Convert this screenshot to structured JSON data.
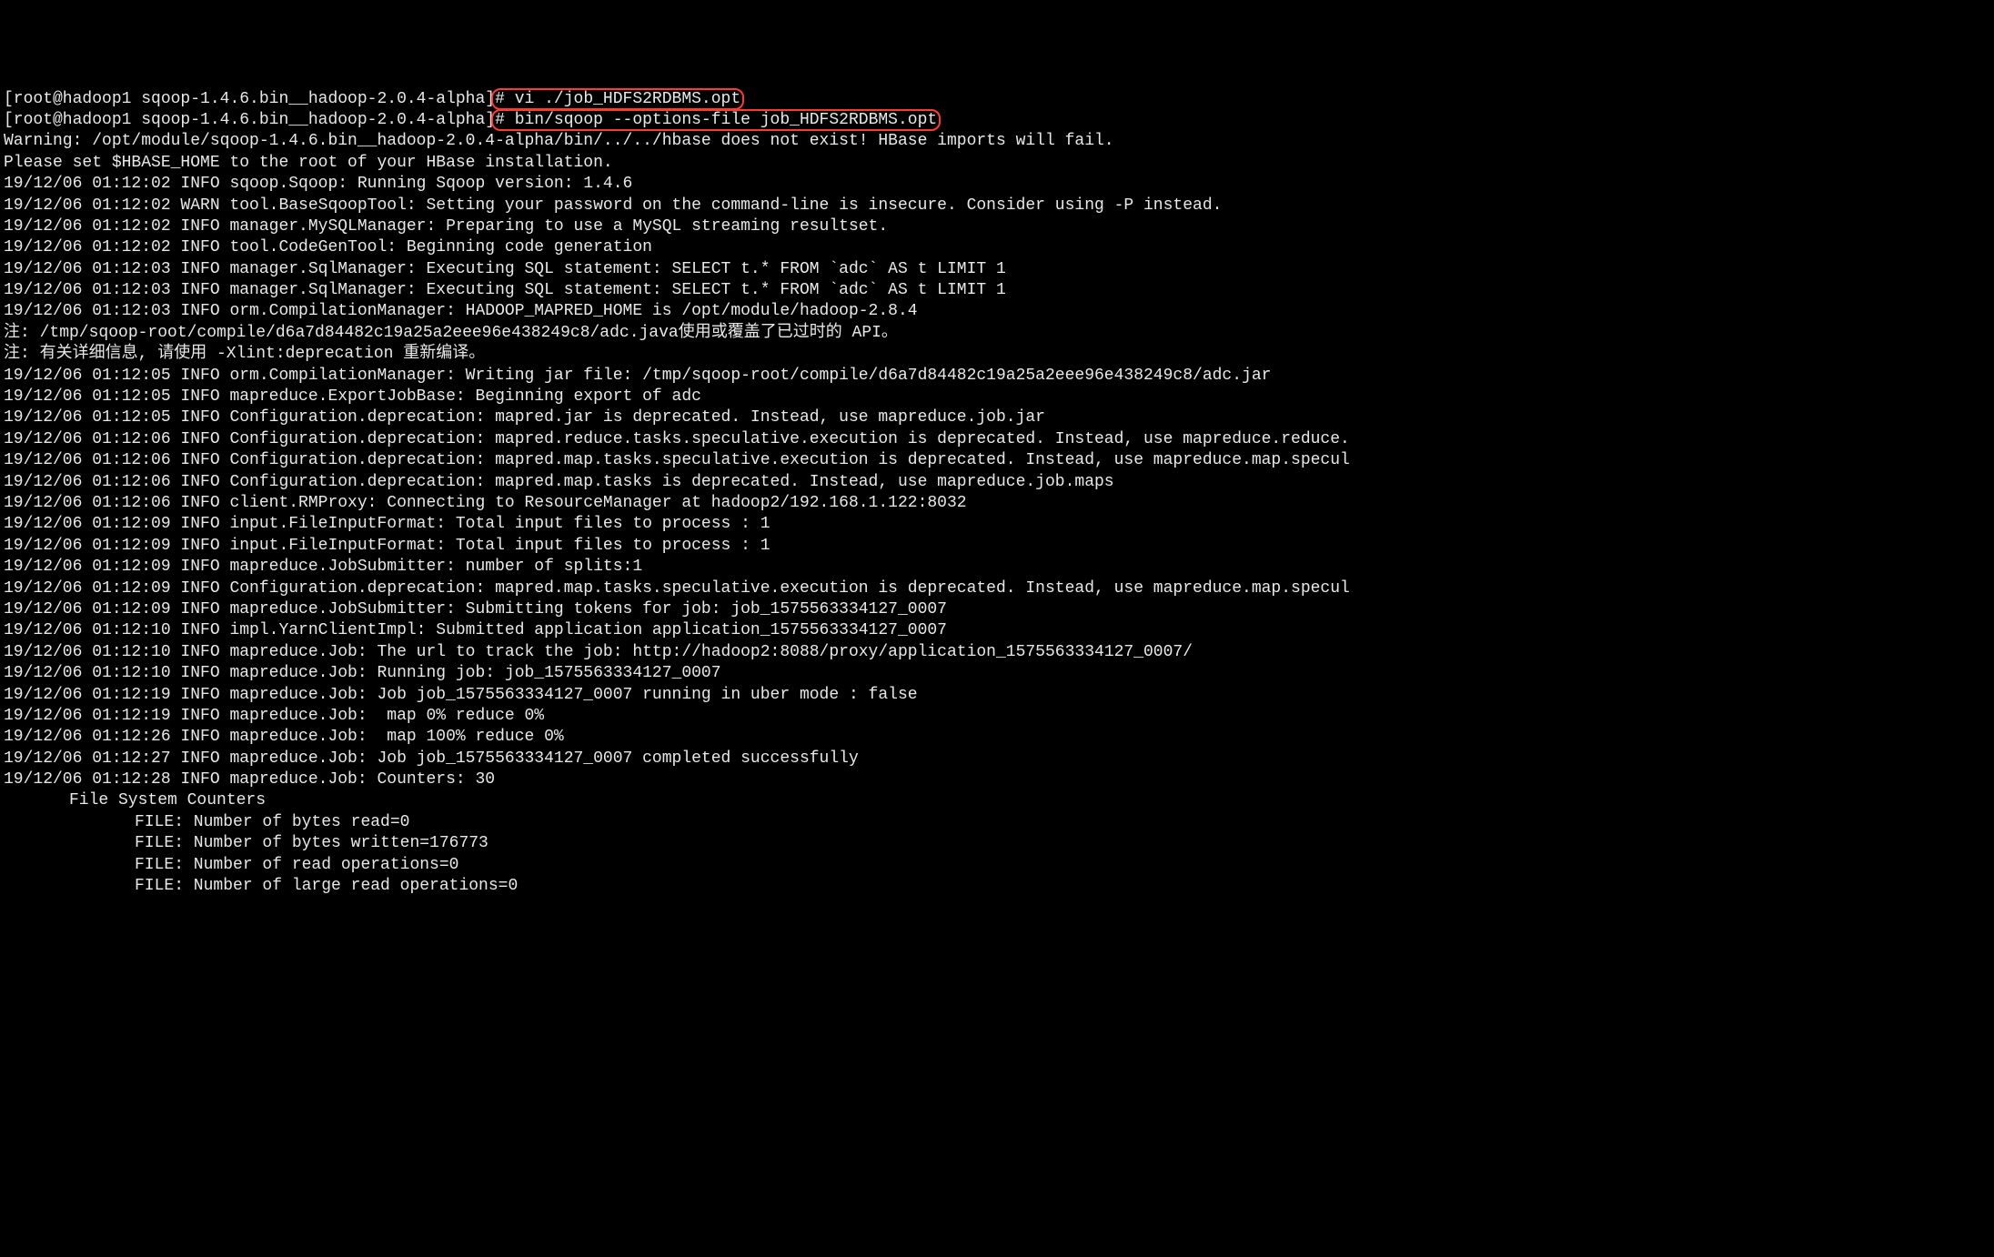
{
  "terminal": {
    "lines": [
      {
        "prompt": "[root@hadoop1 sqoop-1.4.6.bin__hadoop-2.0.4-alpha]",
        "cmd_prefix": "# ",
        "cmd": "vi ./job_HDFS2RDBMS.opt",
        "highlight": true,
        "highlight_start": "cmd_prefix"
      },
      {
        "prompt": "[root@hadoop1 sqoop-1.4.6.bin__hadoop-2.0.4-alpha]",
        "cmd_prefix": "# ",
        "cmd": "bin/sqoop --options-file job_HDFS2RDBMS.opt",
        "highlight": true,
        "highlight_start": "cmd_prefix"
      },
      {
        "text": "Warning: /opt/module/sqoop-1.4.6.bin__hadoop-2.0.4-alpha/bin/../../hbase does not exist! HBase imports will fail."
      },
      {
        "text": "Please set $HBASE_HOME to the root of your HBase installation."
      },
      {
        "text": "19/12/06 01:12:02 INFO sqoop.Sqoop: Running Sqoop version: 1.4.6"
      },
      {
        "text": "19/12/06 01:12:02 WARN tool.BaseSqoopTool: Setting your password on the command-line is insecure. Consider using -P instead."
      },
      {
        "text": "19/12/06 01:12:02 INFO manager.MySQLManager: Preparing to use a MySQL streaming resultset."
      },
      {
        "text": "19/12/06 01:12:02 INFO tool.CodeGenTool: Beginning code generation"
      },
      {
        "text": "19/12/06 01:12:03 INFO manager.SqlManager: Executing SQL statement: SELECT t.* FROM `adc` AS t LIMIT 1"
      },
      {
        "text": "19/12/06 01:12:03 INFO manager.SqlManager: Executing SQL statement: SELECT t.* FROM `adc` AS t LIMIT 1"
      },
      {
        "text": "19/12/06 01:12:03 INFO orm.CompilationManager: HADOOP_MAPRED_HOME is /opt/module/hadoop-2.8.4"
      },
      {
        "text": "注: /tmp/sqoop-root/compile/d6a7d84482c19a25a2eee96e438249c8/adc.java使用或覆盖了已过时的 API。"
      },
      {
        "text": "注: 有关详细信息, 请使用 -Xlint:deprecation 重新编译。"
      },
      {
        "text": "19/12/06 01:12:05 INFO orm.CompilationManager: Writing jar file: /tmp/sqoop-root/compile/d6a7d84482c19a25a2eee96e438249c8/adc.jar"
      },
      {
        "text": "19/12/06 01:12:05 INFO mapreduce.ExportJobBase: Beginning export of adc"
      },
      {
        "text": "19/12/06 01:12:05 INFO Configuration.deprecation: mapred.jar is deprecated. Instead, use mapreduce.job.jar"
      },
      {
        "text": "19/12/06 01:12:06 INFO Configuration.deprecation: mapred.reduce.tasks.speculative.execution is deprecated. Instead, use mapreduce.reduce."
      },
      {
        "text": "19/12/06 01:12:06 INFO Configuration.deprecation: mapred.map.tasks.speculative.execution is deprecated. Instead, use mapreduce.map.specul"
      },
      {
        "text": "19/12/06 01:12:06 INFO Configuration.deprecation: mapred.map.tasks is deprecated. Instead, use mapreduce.job.maps"
      },
      {
        "text": "19/12/06 01:12:06 INFO client.RMProxy: Connecting to ResourceManager at hadoop2/192.168.1.122:8032"
      },
      {
        "text": "19/12/06 01:12:09 INFO input.FileInputFormat: Total input files to process : 1"
      },
      {
        "text": "19/12/06 01:12:09 INFO input.FileInputFormat: Total input files to process : 1"
      },
      {
        "text": "19/12/06 01:12:09 INFO mapreduce.JobSubmitter: number of splits:1"
      },
      {
        "text": "19/12/06 01:12:09 INFO Configuration.deprecation: mapred.map.tasks.speculative.execution is deprecated. Instead, use mapreduce.map.specul"
      },
      {
        "text": "19/12/06 01:12:09 INFO mapreduce.JobSubmitter: Submitting tokens for job: job_1575563334127_0007"
      },
      {
        "text": "19/12/06 01:12:10 INFO impl.YarnClientImpl: Submitted application application_1575563334127_0007"
      },
      {
        "text": "19/12/06 01:12:10 INFO mapreduce.Job: The url to track the job: http://hadoop2:8088/proxy/application_1575563334127_0007/"
      },
      {
        "text": "19/12/06 01:12:10 INFO mapreduce.Job: Running job: job_1575563334127_0007"
      },
      {
        "text": "19/12/06 01:12:19 INFO mapreduce.Job: Job job_1575563334127_0007 running in uber mode : false"
      },
      {
        "text": "19/12/06 01:12:19 INFO mapreduce.Job:  map 0% reduce 0%"
      },
      {
        "text": "19/12/06 01:12:26 INFO mapreduce.Job:  map 100% reduce 0%"
      },
      {
        "text": "19/12/06 01:12:27 INFO mapreduce.Job: Job job_1575563334127_0007 completed successfully"
      },
      {
        "text": "19/12/06 01:12:28 INFO mapreduce.Job: Counters: 30"
      },
      {
        "text": "File System Counters",
        "indent": 1
      },
      {
        "text": "FILE: Number of bytes read=0",
        "indent": 2
      },
      {
        "text": "FILE: Number of bytes written=176773",
        "indent": 2
      },
      {
        "text": "FILE: Number of read operations=0",
        "indent": 2
      },
      {
        "text": "FILE: Number of large read operations=0",
        "indent": 2
      }
    ]
  }
}
